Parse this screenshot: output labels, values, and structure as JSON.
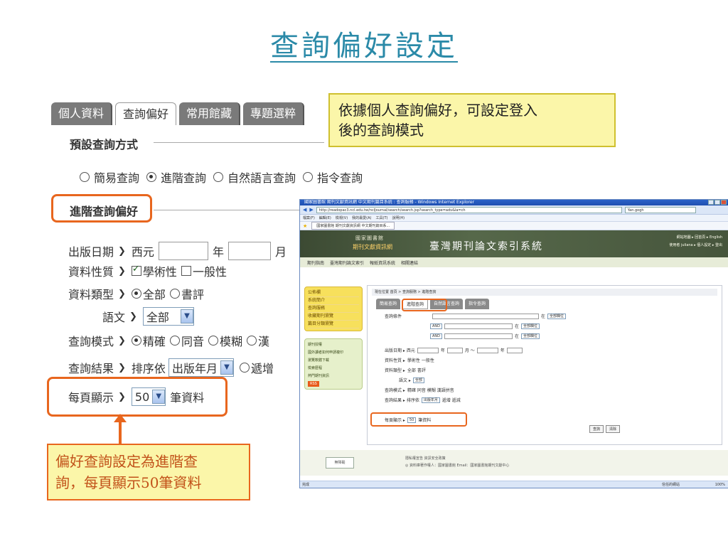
{
  "title": "查詢偏好設定",
  "tabs": [
    "個人資料",
    "查詢偏好",
    "常用館藏",
    "專題選粹"
  ],
  "callout_top": {
    "line1": "依據個人查詢偏好，可設定登入",
    "line2": "後的查詢模式"
  },
  "default_section": {
    "title": "預設查詢方式",
    "options": [
      "簡易查詢",
      "進階查詢",
      "自然語言查詢",
      "指令查詢"
    ],
    "selected": "進階查詢"
  },
  "advanced_section": {
    "title": "進階查詢偏好"
  },
  "form": {
    "pub_date": {
      "label": "出版日期",
      "prefix": "西元",
      "year": "年",
      "month": "月"
    },
    "material": {
      "label": "資料性質",
      "opt1": "學術性",
      "opt2": "一般性"
    },
    "type": {
      "label": "資料類型",
      "opt1": "全部",
      "opt2": "書評"
    },
    "language": {
      "label": "語文",
      "value": "全部"
    },
    "mode": {
      "label": "查詢模式",
      "opt1": "精確",
      "opt2": "同音",
      "opt3": "模糊",
      "opt4": "漢"
    },
    "result": {
      "label": "查詢結果",
      "prefix": "排序依",
      "value": "出版年月",
      "opt1": "遞增"
    },
    "per_page": {
      "label": "每頁顯示",
      "value": "50",
      "suffix": "筆資料"
    }
  },
  "callout_bottom": {
    "line1": "偏好查詢設定為進階查",
    "line2": "詢，每頁顯示50筆資料"
  },
  "browser": {
    "window_title": "國家圖書館 期刊文獻資訊網 中文期刊篇目系統 : 查詢服務 - Windows Internet Explorer",
    "url": "http://readopac3.ncl.edu.tw/nclJournal/search/search.jsp?search_type=adv&la=ch",
    "search_box": "Yan.gogh",
    "menu": [
      "檔案(F)",
      "編輯(E)",
      "檢視(V)",
      "我的最愛(A)",
      "工具(T)",
      "說明(H)"
    ],
    "fav_tab": "國家圖書館 期刊文獻資訊網 中文期刊篇目系...",
    "banner_lib": "國家圖書館",
    "banner_sub": "期刊文獻資訊網",
    "banner_sys": "臺灣期刊論文索引系統",
    "banner_links": "網站地圖 ▸ 回首頁 ▸ English",
    "banner_user": "使用者 juliana ▸ 個人設定 ▸ 登出",
    "nav": [
      "期刊指南",
      "臺灣期刊論文索引",
      "報紙資訊系統",
      "相關連結"
    ],
    "side_yellow": [
      "公佈欄",
      "系統簡介",
      "查詢服務",
      "收藏期刊瀏覽",
      "篇目分類瀏覽"
    ],
    "side_green": [
      "期刊授權",
      "國外讀者如何申請複印",
      "瀏覽軟體下載",
      "檢索歷程",
      "熱門期刊資訊",
      "RSS"
    ],
    "breadcrumb": "現在位置 首頁 > 查詢服務 > 進階查詢",
    "tabs": [
      "簡易查詢",
      "進階查詢",
      "自然語言查詢",
      "指令查詢"
    ],
    "query_label": "查詢條件",
    "and": "AND",
    "in": "在",
    "all_fields": "全部欄位",
    "rows": {
      "date": "出版日期 ▸ 西元",
      "year": "年",
      "month": "月 ～",
      "material": "資料性質 ▸",
      "material_opts": "學術性  一般性",
      "type": "資料類型 ▸",
      "type_opts": "全部  書評",
      "lang": "語文 ▸",
      "lang_val": "全部",
      "mode": "查詢模式 ▸",
      "mode_opts": "精確  同音  模糊  漢語拼音",
      "result": "查詢結果 ▸ 排序依",
      "result_val": "出版年月",
      "result_opts": "遞增  遞減",
      "per_page": "每頁顯示 ▸",
      "per_page_val": "50",
      "per_page_suffix": "筆資料"
    },
    "buttons": [
      "查詢",
      "清除"
    ],
    "footer1": "隱私權宣告   資訊安全政策",
    "footer2": "◎ 資料庫著作權人：國家圖書館   Email：國家圖書館期刊文獻中心",
    "footer_logo": "無障礙",
    "status_left": "完成",
    "status_mid": "信任的網站",
    "status_right": "100%"
  }
}
